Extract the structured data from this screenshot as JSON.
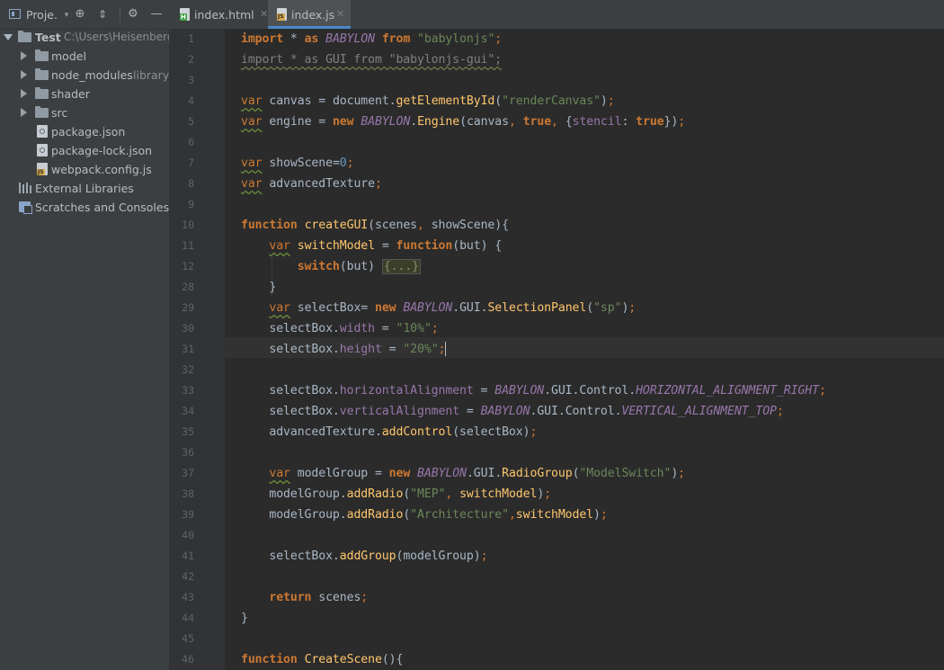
{
  "sidebar": {
    "title": "Proje.",
    "tree": [
      {
        "label": "Test",
        "hint": "C:\\Users\\Heisenberg",
        "kind": "root-folder",
        "expanded": true
      },
      {
        "label": "model",
        "hint": "",
        "kind": "folder",
        "expanded": false
      },
      {
        "label": "node_modules",
        "hint": "library",
        "kind": "folder",
        "expanded": false
      },
      {
        "label": "shader",
        "hint": "",
        "kind": "folder",
        "expanded": false
      },
      {
        "label": "src",
        "hint": "",
        "kind": "folder",
        "expanded": false
      },
      {
        "label": "package.json",
        "hint": "",
        "kind": "json-file"
      },
      {
        "label": "package-lock.json",
        "hint": "",
        "kind": "json-file"
      },
      {
        "label": "webpack.config.js",
        "hint": "",
        "kind": "js-file"
      },
      {
        "label": "External Libraries",
        "hint": "",
        "kind": "libraries"
      },
      {
        "label": "Scratches and Consoles",
        "hint": "",
        "kind": "scratches"
      }
    ]
  },
  "tabs": [
    {
      "label": "index.html",
      "active": false
    },
    {
      "label": "index.js",
      "active": true
    }
  ],
  "editor": {
    "line_numbers": [
      "1",
      "2",
      "3",
      "4",
      "5",
      "6",
      "7",
      "8",
      "9",
      "10",
      "11",
      "12",
      "28",
      "29",
      "30",
      "31",
      "32",
      "33",
      "34",
      "35",
      "36",
      "37",
      "38",
      "39",
      "40",
      "41",
      "42",
      "43",
      "44",
      "45",
      "46"
    ],
    "lines": [
      {
        "t": "import * as BABYLON from \"babylonjs\";"
      },
      {
        "t": "import * as GUI from \"babylonjs-gui\";"
      },
      {
        "t": ""
      },
      {
        "t": "var canvas = document.getElementById(\"renderCanvas\");"
      },
      {
        "t": "var engine = new BABYLON.Engine(canvas, true, {stencil: true});"
      },
      {
        "t": ""
      },
      {
        "t": "var showScene=0;"
      },
      {
        "t": "var advancedTexture;"
      },
      {
        "t": ""
      },
      {
        "t": "function createGUI(scenes, showScene){"
      },
      {
        "t": "    var switchModel = function(but) {"
      },
      {
        "t": "        switch(but) {...}"
      },
      {
        "t": "    }"
      },
      {
        "t": "    var selectBox= new BABYLON.GUI.SelectionPanel(\"sp\");"
      },
      {
        "t": "    selectBox.width = \"10%\";"
      },
      {
        "t": "    selectBox.height = \"20%\";"
      },
      {
        "t": ""
      },
      {
        "t": "    selectBox.horizontalAlignment = BABYLON.GUI.Control.HORIZONTAL_ALIGNMENT_RIGHT;"
      },
      {
        "t": "    selectBox.verticalAlignment = BABYLON.GUI.Control.VERTICAL_ALIGNMENT_TOP;"
      },
      {
        "t": "    advancedTexture.addControl(selectBox);"
      },
      {
        "t": ""
      },
      {
        "t": "    var modelGroup = new BABYLON.GUI.RadioGroup(\"ModelSwitch\");"
      },
      {
        "t": "    modelGroup.addRadio(\"MEP\", switchModel);"
      },
      {
        "t": "    modelGroup.addRadio(\"Architecture\",switchModel);"
      },
      {
        "t": ""
      },
      {
        "t": "    selectBox.addGroup(modelGroup);"
      },
      {
        "t": ""
      },
      {
        "t": "    return scenes;"
      },
      {
        "t": "}"
      },
      {
        "t": ""
      },
      {
        "t": "function CreateScene(){"
      }
    ]
  }
}
